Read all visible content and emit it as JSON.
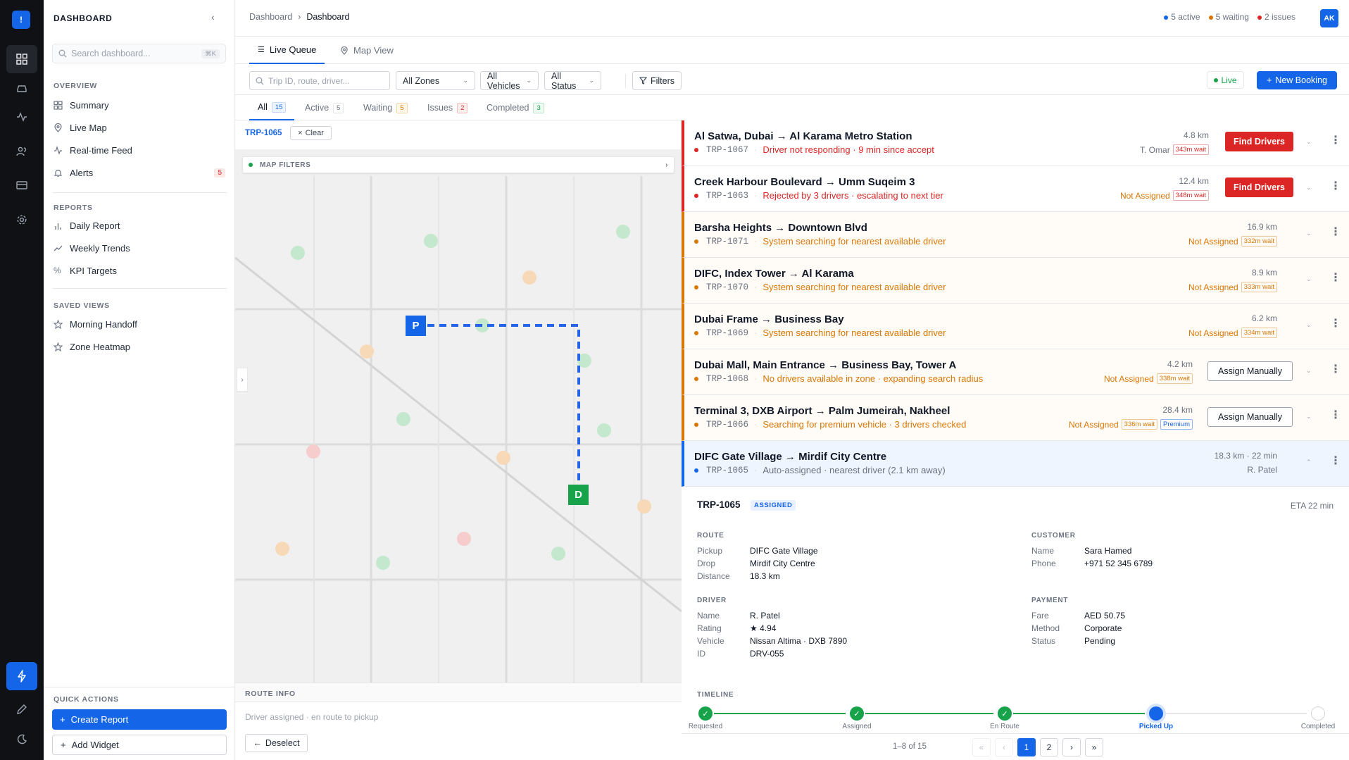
{
  "rail": {
    "logo": "!"
  },
  "sidebar": {
    "title": "DASHBOARD",
    "search_placeholder": "Search dashboard...",
    "search_shortcut": "⌘K",
    "overview_label": "OVERVIEW",
    "overview": [
      {
        "label": "Summary",
        "icon": "grid-icon"
      },
      {
        "label": "Live Map",
        "icon": "map-pin-icon"
      },
      {
        "label": "Real-time Feed",
        "icon": "activity-icon"
      },
      {
        "label": "Alerts",
        "icon": "bell-icon",
        "badge": "5"
      }
    ],
    "reports_label": "REPORTS",
    "reports": [
      {
        "label": "Daily Report",
        "icon": "bar-chart-icon"
      },
      {
        "label": "Weekly Trends",
        "icon": "trend-icon"
      },
      {
        "label": "KPI Targets",
        "icon": "percent-icon"
      }
    ],
    "saved_label": "SAVED VIEWS",
    "saved": [
      {
        "label": "Morning Handoff",
        "icon": "star-icon"
      },
      {
        "label": "Zone Heatmap",
        "icon": "star-icon"
      }
    ],
    "quick_label": "QUICK ACTIONS",
    "create_report": "Create Report",
    "add_widget": "Add Widget"
  },
  "topbar": {
    "crumb_root": "Dashboard",
    "crumb_current": "Dashboard",
    "stat_active": "5 active",
    "stat_waiting": "5 waiting",
    "stat_issues": "2 issues",
    "avatar": "AK"
  },
  "viewtabs": {
    "live_queue": "Live Queue",
    "map_view": "Map View"
  },
  "filters": {
    "search_placeholder": "Trip ID, route, driver...",
    "zones": "All Zones",
    "vehicles": "All Vehicles",
    "status": "All Status",
    "filters_btn": "Filters",
    "live": "Live",
    "new_booking": "New Booking"
  },
  "status_tabs": [
    {
      "label": "All",
      "count": "15"
    },
    {
      "label": "Active",
      "count": "5"
    },
    {
      "label": "Waiting",
      "count": "5"
    },
    {
      "label": "Issues",
      "count": "2"
    },
    {
      "label": "Completed",
      "count": "3"
    }
  ],
  "map": {
    "selected_trip": "TRP-1065",
    "clear": "Clear",
    "filters_label": "MAP FILTERS",
    "pickup_marker": "P",
    "drop_marker": "D"
  },
  "route_info": {
    "title": "ROUTE INFO",
    "body": "Driver assigned · en route to pickup",
    "deselect": "Deselect"
  },
  "trips": [
    {
      "route": "Al Satwa, Dubai → Al Karama Metro Station",
      "id": "TRP-1067",
      "note": "Driver not responding · 9 min since accept",
      "km": "4.8 km",
      "assignee": "T. Omar",
      "wait": "343m wait",
      "action": "Find Drivers",
      "tone": "red"
    },
    {
      "route": "Creek Harbour Boulevard → Umm Suqeim 3",
      "id": "TRP-1063",
      "note": "Rejected by 3 drivers · escalating to next tier",
      "km": "12.4 km",
      "assignee": "Not Assigned",
      "wait": "348m wait",
      "action": "Find Drivers",
      "tone": "red"
    },
    {
      "route": "Barsha Heights → Downtown Blvd",
      "id": "TRP-1071",
      "note": "System searching for nearest available driver",
      "km": "16.9 km",
      "assignee": "Not Assigned",
      "wait": "332m wait",
      "action": "",
      "tone": "orange"
    },
    {
      "route": "DIFC, Index Tower → Al Karama",
      "id": "TRP-1070",
      "note": "System searching for nearest available driver",
      "km": "8.9 km",
      "assignee": "Not Assigned",
      "wait": "333m wait",
      "action": "",
      "tone": "orange"
    },
    {
      "route": "Dubai Frame → Business Bay",
      "id": "TRP-1069",
      "note": "System searching for nearest available driver",
      "km": "6.2 km",
      "assignee": "Not Assigned",
      "wait": "334m wait",
      "action": "",
      "tone": "orange"
    },
    {
      "route": "Dubai Mall, Main Entrance → Business Bay, Tower A",
      "id": "TRP-1068",
      "note": "No drivers available in zone · expanding search radius",
      "km": "4.2 km",
      "assignee": "Not Assigned",
      "wait": "338m wait",
      "action": "Assign Manually",
      "tone": "orange"
    },
    {
      "route": "Terminal 3, DXB Airport → Palm Jumeirah, Nakheel",
      "id": "TRP-1066",
      "note": "Searching for premium vehicle · 3 drivers checked",
      "km": "28.4 km",
      "assignee": "Not Assigned",
      "wait": "336m wait",
      "premium": "Premium",
      "action": "Assign Manually",
      "tone": "orange"
    },
    {
      "route": "DIFC Gate Village → Mirdif City Centre",
      "id": "TRP-1065",
      "note": "Auto-assigned · nearest driver (2.1 km away)",
      "km": "18.3 km · 22 min",
      "assignee": "R. Patel",
      "wait": "",
      "action": "",
      "tone": "blue"
    }
  ],
  "detail": {
    "id": "TRP-1065",
    "badge": "ASSIGNED",
    "eta": "ETA 22 min",
    "route_label": "ROUTE",
    "route": [
      [
        "Pickup",
        "DIFC Gate Village"
      ],
      [
        "Drop",
        "Mirdif City Centre"
      ],
      [
        "Distance",
        "18.3 km"
      ]
    ],
    "customer_label": "CUSTOMER",
    "customer": [
      [
        "Name",
        "Sara Hamed"
      ],
      [
        "Phone",
        "+971 52 345 6789"
      ]
    ],
    "driver_label": "DRIVER",
    "driver": [
      [
        "Name",
        "R. Patel"
      ],
      [
        "Rating",
        "★ 4.94"
      ],
      [
        "Vehicle",
        "Nissan Altima · DXB 7890"
      ],
      [
        "ID",
        "DRV-055"
      ]
    ],
    "payment_label": "PAYMENT",
    "payment": [
      [
        "Fare",
        "AED 50.75"
      ],
      [
        "Method",
        "Corporate"
      ],
      [
        "Status",
        "Pending"
      ]
    ],
    "timeline_label": "TIMELINE",
    "timeline": [
      {
        "label": "Requested",
        "state": "done"
      },
      {
        "label": "Assigned",
        "state": "done"
      },
      {
        "label": "En Route",
        "state": "done"
      },
      {
        "label": "Picked Up",
        "state": "current"
      },
      {
        "label": "Completed",
        "state": "todo"
      }
    ]
  },
  "pager": {
    "info": "1–8 of 15",
    "first": "«",
    "prev": "‹",
    "p1": "1",
    "p2": "2",
    "next": "›",
    "last": "»"
  },
  "colors": {
    "accent": "#1565e8",
    "red": "#dc2626",
    "orange": "#d97706",
    "green": "#16a34a"
  }
}
